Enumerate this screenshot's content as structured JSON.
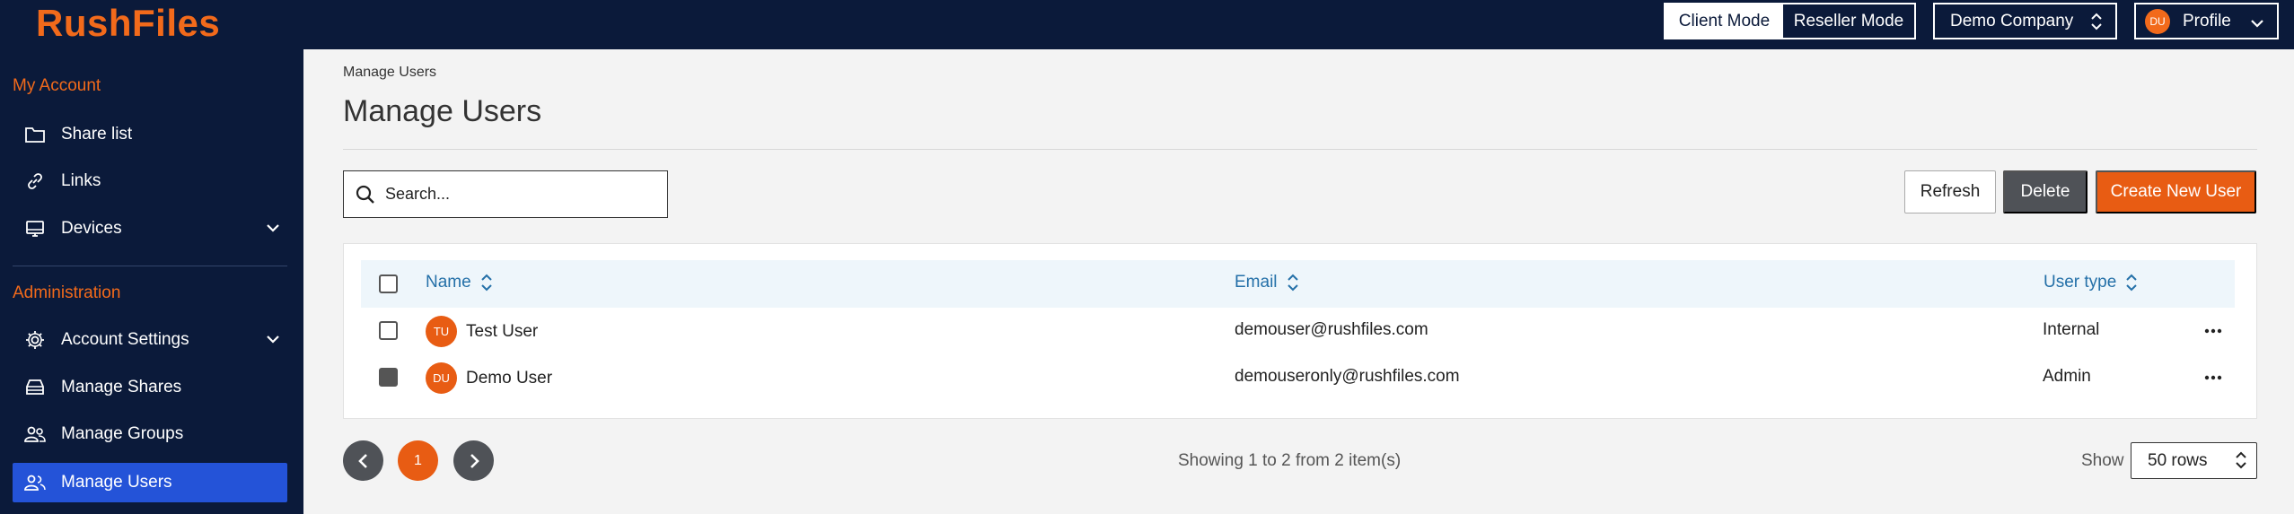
{
  "app": {
    "logo": "RushFiles"
  },
  "topbar": {
    "client_mode": "Client Mode",
    "reseller_mode": "Reseller Mode",
    "company": "Demo Company",
    "profile_initials": "DU",
    "profile_label": "Profile"
  },
  "sidebar": {
    "my_account_title": "My Account",
    "my_account_items": [
      {
        "label": "Share list",
        "icon": "folder-icon"
      },
      {
        "label": "Links",
        "icon": "link-icon"
      },
      {
        "label": "Devices",
        "icon": "monitor-icon",
        "expandable": true
      }
    ],
    "admin_title": "Administration",
    "admin_items": [
      {
        "label": "Account Settings",
        "icon": "gear-icon",
        "expandable": true
      },
      {
        "label": "Manage Shares",
        "icon": "storage-icon"
      },
      {
        "label": "Manage Groups",
        "icon": "group-icon"
      },
      {
        "label": "Manage Users",
        "icon": "users-icon",
        "active": true
      }
    ]
  },
  "main": {
    "breadcrumb": "Manage Users",
    "title": "Manage Users",
    "search_placeholder": "Search...",
    "refresh_label": "Refresh",
    "delete_label": "Delete",
    "create_label": "Create New User"
  },
  "table": {
    "columns": {
      "name": "Name",
      "email": "Email",
      "user_type": "User type"
    },
    "rows": [
      {
        "initials": "TU",
        "name": "Test User",
        "email": "demouser@rushfiles.com",
        "user_type": "Internal",
        "checked": false
      },
      {
        "initials": "DU",
        "name": "Demo User",
        "email": "demouseronly@rushfiles.com",
        "user_type": "Admin",
        "checked": true
      }
    ]
  },
  "pagination": {
    "current_page": "1",
    "showing_text": "Showing 1 to 2 from 2 item(s)",
    "show_label": "Show",
    "rows_value": "50 rows"
  },
  "colors": {
    "navy": "#0b1a3a",
    "accent": "#e85c13",
    "active_nav": "#2453d8",
    "header_text": "#2470a8"
  }
}
